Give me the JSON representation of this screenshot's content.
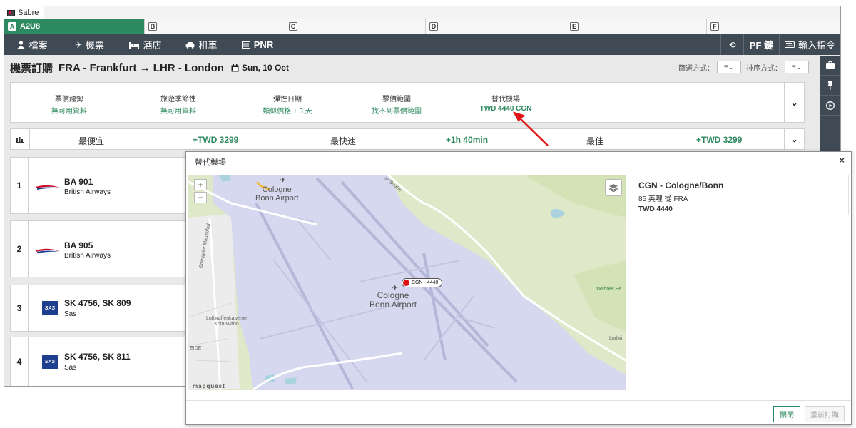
{
  "window": {
    "title": "Sabre"
  },
  "sessions": [
    {
      "key": "A",
      "label": "A2U8"
    },
    {
      "key": "B",
      "label": ""
    },
    {
      "key": "C",
      "label": ""
    },
    {
      "key": "D",
      "label": ""
    },
    {
      "key": "E",
      "label": ""
    },
    {
      "key": "F",
      "label": ""
    }
  ],
  "toolbar": {
    "files": "檔案",
    "air": "機票",
    "hotel": "酒店",
    "car": "租車",
    "pnr": "PNR",
    "pf_keys": "PF 鍵",
    "command": "輸入指令"
  },
  "header": {
    "title": "機票訂購",
    "route": "FRA - Frankfurt → LHR - London",
    "date": "Sun, 10 Oct",
    "filter_label": "篩選方式：",
    "sort_label": "排序方式："
  },
  "filters": [
    {
      "label": "票價趨勢",
      "value": "無可用資料"
    },
    {
      "label": "旅遊季節性",
      "value": "無可用資料"
    },
    {
      "label": "彈性日期",
      "value": "類似價格 ± 3 天"
    },
    {
      "label": "票價範圍",
      "value": "找不到票價範圍"
    },
    {
      "label": "替代機場",
      "value": "TWD 4440 CGN"
    }
  ],
  "summary": {
    "cheapest_label": "最便宜",
    "cheapest_value": "+TWD 3299",
    "fastest_label": "最快速",
    "fastest_value": "+1h 40min",
    "best_label": "最佳",
    "best_value": "+TWD 3299"
  },
  "flights": [
    {
      "num": "1",
      "flight": "BA 901",
      "airline": "British Airways",
      "logo": "ba"
    },
    {
      "num": "2",
      "flight": "BA 905",
      "airline": "British Airways",
      "logo": "ba"
    },
    {
      "num": "3",
      "flight": "SK 4756, SK 809",
      "airline": "Sas",
      "logo": "sas"
    },
    {
      "num": "4",
      "flight": "SK 4756, SK 811",
      "airline": "Sas",
      "logo": "sas"
    }
  ],
  "modal": {
    "title": "替代機場",
    "close_symbol": "×",
    "map": {
      "zoom_in": "+",
      "zoom_out": "−",
      "label_airport_top": "Cologne\nBonn Airport",
      "label_airport_center": "Cologne\nBonn Airport",
      "label_kaserne": "Luftwaffenkaserne\nKöln-Wahn",
      "label_street": "Grengeler Mauspfad",
      "label_strasse": "er Straße",
      "label_wahner": "Wahner He",
      "label_ludwig": "Ludwi",
      "label_eide": "EIDE",
      "pin_label": "CGN - 4440",
      "attribution": "mapquest"
    },
    "info": {
      "code": "CGN - Cologne/Bonn",
      "distance": "85 英哩 從 FRA",
      "price": "TWD 4440"
    },
    "buttons": {
      "close": "關閉",
      "rebook": "重新訂購"
    }
  },
  "colors": {
    "accent": "#2e8a60",
    "toolbar": "#3f4a54",
    "map_airport": "#d6d8ef",
    "map_green": "#dfe9c9"
  }
}
